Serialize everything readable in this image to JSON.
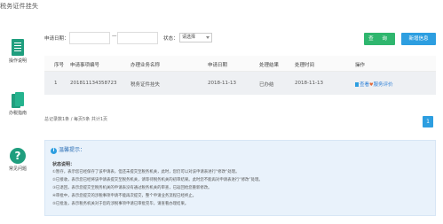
{
  "page": {
    "title": "税务证件挂失"
  },
  "sidebar": {
    "items": [
      {
        "label": "操作说明",
        "icon": "document-list-icon"
      },
      {
        "label": "办税指南",
        "icon": "book-icon"
      },
      {
        "label": "常见问题",
        "icon": "question-icon"
      }
    ]
  },
  "search": {
    "date_label": "申请日期：",
    "date_separator": "—",
    "date_from": "",
    "date_to": "",
    "status_label": "状态：",
    "status_value": "请选择"
  },
  "buttons": {
    "query": "查 询",
    "add": "新增信息"
  },
  "table": {
    "headers": [
      "序号",
      "申请事项编号",
      "办理业务名称",
      "申请日期",
      "处理结果",
      "处理时间",
      "操作"
    ],
    "rows": [
      {
        "index": "1",
        "number": "201811134358723",
        "business": "税务证件挂失",
        "apply_date": "2018-11-13",
        "result": "已办结",
        "process_date": "2018-11-13",
        "op_view": "查看",
        "op_evaluate": "服务评价"
      }
    ]
  },
  "pager": {
    "info": "总记录数1条 / 每页5条 共计1页",
    "current_page": "1"
  },
  "tips": {
    "title": "温馨提示：",
    "subtitle": "状态说明：",
    "lines": [
      "①暂存，表示您已经保存了该申请表，但还未提交至税务机关，此时，您仍可以对该申请表进行“修改”处理。",
      "②已接收，表示您已经将该申请表提交至税务机关，请等待税务机关的初审结果。此时您不能再对申请表进行“修改”处理。",
      "③已退回，表示您提交至税务机关的申请表没有通过税务机关的审查，已返回给您重新修改。",
      "④审批中，表示您提交的涉税事项申请不能再次提交，整个申请业务流程已经终止。",
      "⑤已批准，表示税务机关对于您的涉税事项申请已审批完毕，请查看办理结果。"
    ]
  }
}
